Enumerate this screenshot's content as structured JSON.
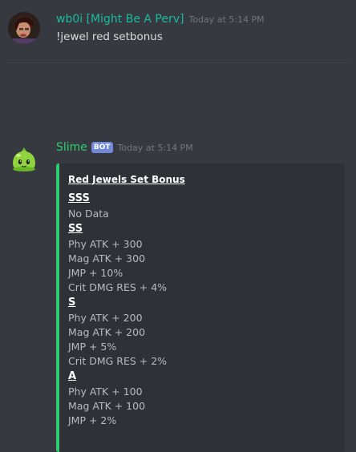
{
  "messages": [
    {
      "author": "wb0i [Might Be A Perv]",
      "timestamp": "Today at 5:14 PM",
      "content": "!jewel red setbonus",
      "author_color": "#1abc9c"
    },
    {
      "author": "Slime",
      "bot_tag": "BOT",
      "timestamp": "Today at 5:14 PM",
      "author_color": "#2ecc71",
      "embed": {
        "accent_color": "#2ecc71",
        "title": "Red Jewels Set Bonus",
        "sections": [
          {
            "heading": "SSS",
            "lines": [
              "No Data"
            ]
          },
          {
            "heading": "SS",
            "lines": [
              "Phy ATK + 300",
              "Mag ATK + 300",
              "JMP + 10%",
              "Crit DMG RES + 4%"
            ]
          },
          {
            "heading": "S",
            "lines": [
              "Phy ATK + 200",
              "Mag ATK + 200",
              "JMP + 5%",
              "Crit DMG RES + 2%"
            ]
          },
          {
            "heading": "A",
            "lines": [
              "Phy ATK + 100",
              "Mag ATK + 100",
              "JMP + 2%"
            ]
          }
        ]
      }
    }
  ],
  "icons": {
    "user_avatar": "user-avatar-icon",
    "bot_avatar": "slime-avatar-icon"
  }
}
